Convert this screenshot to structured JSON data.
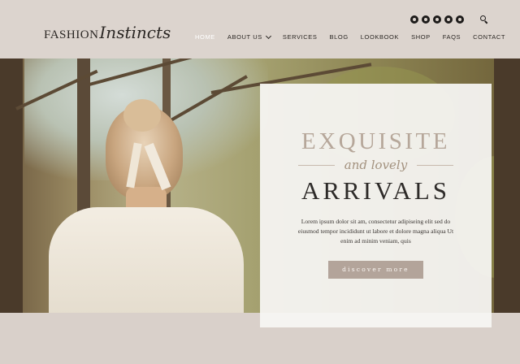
{
  "brand": {
    "logo_part1": "FASHION",
    "logo_part2": "Instincts"
  },
  "social_icons": [
    "instagram-icon",
    "facebook-icon",
    "twitter-icon",
    "youtube-icon",
    "pinterest-icon"
  ],
  "nav": {
    "items": [
      {
        "label": "HOME",
        "active": true
      },
      {
        "label": "ABOUT US",
        "has_dropdown": true
      },
      {
        "label": "SERVICES"
      },
      {
        "label": "BLOG"
      },
      {
        "label": "LOOKBOOK"
      },
      {
        "label": "SHOP"
      },
      {
        "label": "FAQS"
      },
      {
        "label": "CONTACT"
      }
    ]
  },
  "hero": {
    "headline_top": "EXQUISITE",
    "headline_mid": "and lovely",
    "headline_bottom": "ARRIVALS",
    "body": "Lorem ipsum dolor sit am, consectetur adipiseing elit sed do eiusmod tempor incididunt ut labore et dolore magna aliqua Ut enim ad minim veniam, quis",
    "cta_label": "discover more"
  },
  "colors": {
    "header_bg": "#dcd4ce",
    "accent": "#b3a49a",
    "headline_light": "#b6a79a",
    "headline_dark": "#2e2b29"
  }
}
